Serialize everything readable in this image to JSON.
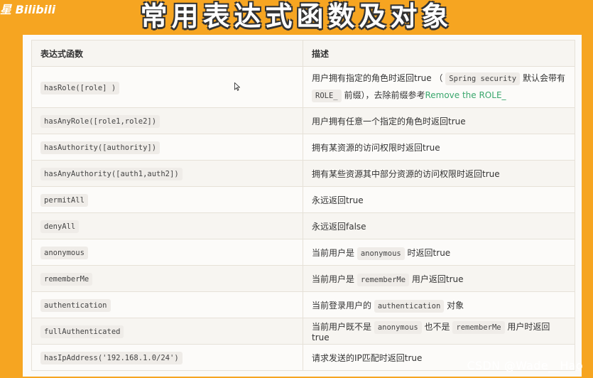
{
  "corner_logo": "星 Bilibili",
  "banner": {
    "title": "常用表达式函数及对象"
  },
  "table": {
    "headers": [
      "表达式函数",
      "描述"
    ],
    "rows": [
      {
        "expr": "hasRole([role] )",
        "desc": {
          "part1": "用户拥有指定的角色时返回true （",
          "code1": "Spring security",
          "part2": " 默认会带有",
          "code2": "ROLE_",
          "part3": " 前缀），去除前缀参考",
          "link": "Remove the ROLE_"
        }
      },
      {
        "expr": "hasAnyRole([role1,role2])",
        "desc": "用户拥有任意一个指定的角色时返回true"
      },
      {
        "expr": "hasAuthority([authority])",
        "desc": "拥有某资源的访问权限时返回true"
      },
      {
        "expr": "hasAnyAuthority([auth1,auth2])",
        "desc": "拥有某些资源其中部分资源的访问权限时返回true"
      },
      {
        "expr": "permitAll",
        "desc": "永远返回true"
      },
      {
        "expr": "denyAll",
        "desc": "永远返回false"
      },
      {
        "expr": "anonymous",
        "desc_pre": "当前用户是 ",
        "desc_code": "anonymous",
        "desc_post": " 时返回true"
      },
      {
        "expr": "rememberMe",
        "desc_pre": "当前用户是 ",
        "desc_code": "rememberMe",
        "desc_post": " 用户返回true"
      },
      {
        "expr": "authentication",
        "desc_pre": "当前登录用户的 ",
        "desc_code": "authentication",
        "desc_post": " 对象"
      },
      {
        "expr": "fullAuthenticated",
        "desc_pre": "当前用户既不是 ",
        "desc_code": "anonymous",
        "desc_mid": " 也不是 ",
        "desc_code2": "rememberMe",
        "desc_post": " 用户时返回true"
      },
      {
        "expr": "hasIpAddress('192.168.1.0/24')",
        "desc": "请求发送的IP匹配时返回true"
      }
    ]
  },
  "watermark": "CSDN @Wade__Hao",
  "icons": {
    "cursor": "mouse-pointer-icon"
  }
}
